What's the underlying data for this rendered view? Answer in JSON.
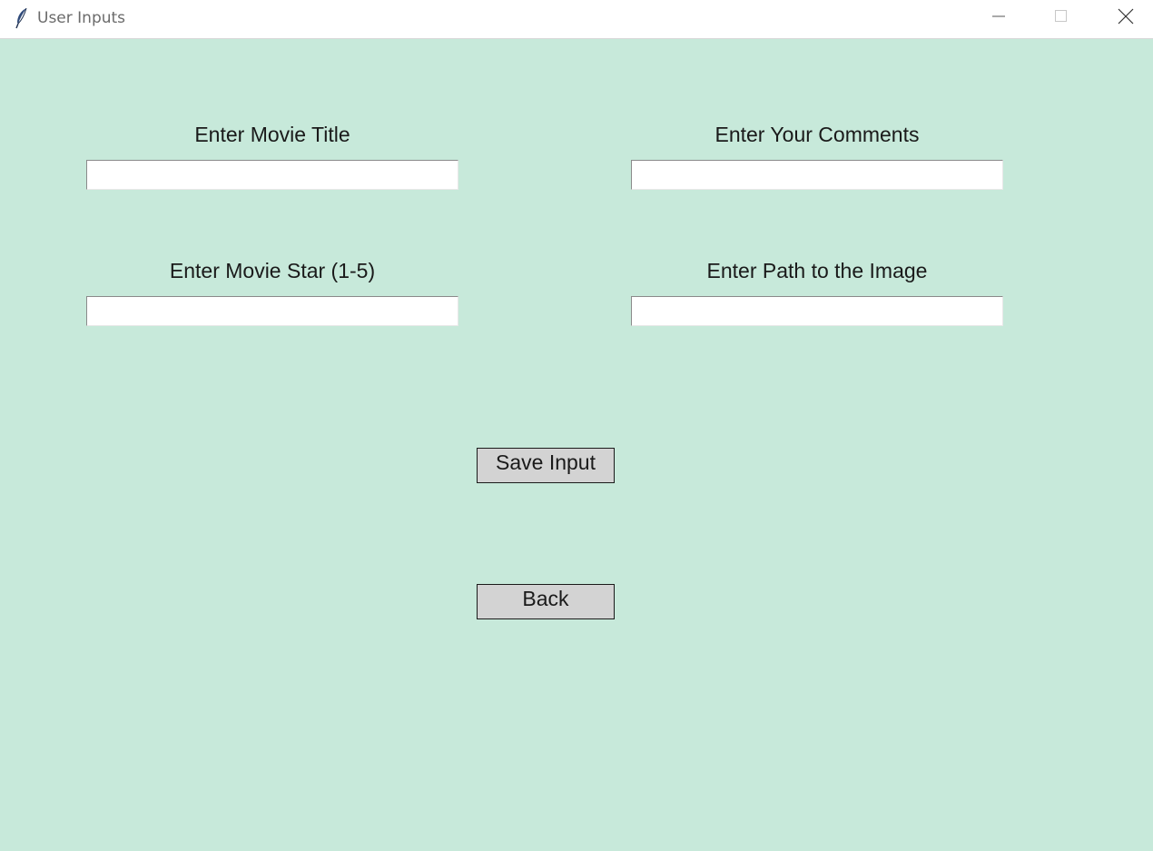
{
  "window": {
    "title": "User Inputs",
    "icon": "feather-icon",
    "background": "#c7e9da"
  },
  "titlebar_buttons": {
    "minimize": "minimize-icon",
    "maximize": "maximize-icon",
    "close": "close-icon"
  },
  "form": {
    "movie_title": {
      "label": "Enter Movie Title",
      "value": ""
    },
    "comments": {
      "label": "Enter Your Comments",
      "value": ""
    },
    "movie_star": {
      "label": "Enter Movie Star (1-5)",
      "value": ""
    },
    "image_path": {
      "label": "Enter Path to the Image",
      "value": ""
    }
  },
  "buttons": {
    "save": "Save Input",
    "back": "Back"
  }
}
